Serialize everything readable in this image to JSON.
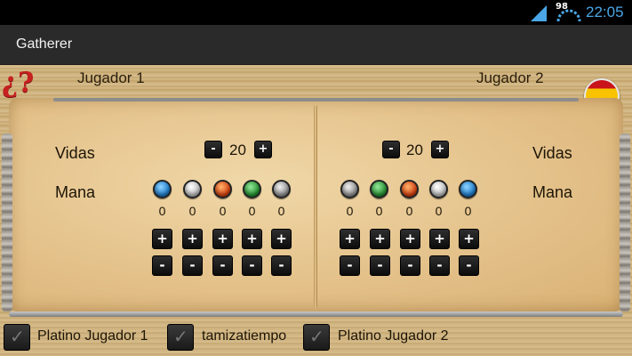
{
  "statusbar": {
    "battery": "98",
    "time": "22:05"
  },
  "app": {
    "title": "Gatherer"
  },
  "header": {
    "help_symbol": "¿?",
    "player1": "Jugador 1",
    "player2": "Jugador 2",
    "language": "flag-spain-icon"
  },
  "player1": {
    "lives_label": "Vidas",
    "mana_label": "Mana",
    "lives": "20",
    "mana": [
      {
        "color": "blue",
        "icon": "mana-blue-icon",
        "count": "0"
      },
      {
        "color": "white",
        "icon": "mana-white-icon",
        "count": "0"
      },
      {
        "color": "red",
        "icon": "mana-red-icon",
        "count": "0"
      },
      {
        "color": "green",
        "icon": "mana-green-icon",
        "count": "0"
      },
      {
        "color": "black",
        "icon": "mana-black-icon",
        "count": "0"
      }
    ]
  },
  "player2": {
    "lives_label": "Vidas",
    "mana_label": "Mana",
    "lives": "20",
    "mana": [
      {
        "color": "black",
        "icon": "mana-black-icon",
        "count": "0"
      },
      {
        "color": "green",
        "icon": "mana-green-icon",
        "count": "0"
      },
      {
        "color": "red",
        "icon": "mana-red-icon",
        "count": "0"
      },
      {
        "color": "white",
        "icon": "mana-white-icon",
        "count": "0"
      },
      {
        "color": "blue",
        "icon": "mana-blue-icon",
        "count": "0"
      }
    ]
  },
  "buttons": {
    "minus": "-",
    "plus": "+"
  },
  "footer": {
    "check1": "Platino Jugador 1",
    "check2": "tamizatiempo",
    "check3": "Platino Jugador 2"
  },
  "colors": {
    "accent_time": "#4aa6e6",
    "help": "#c62020"
  }
}
